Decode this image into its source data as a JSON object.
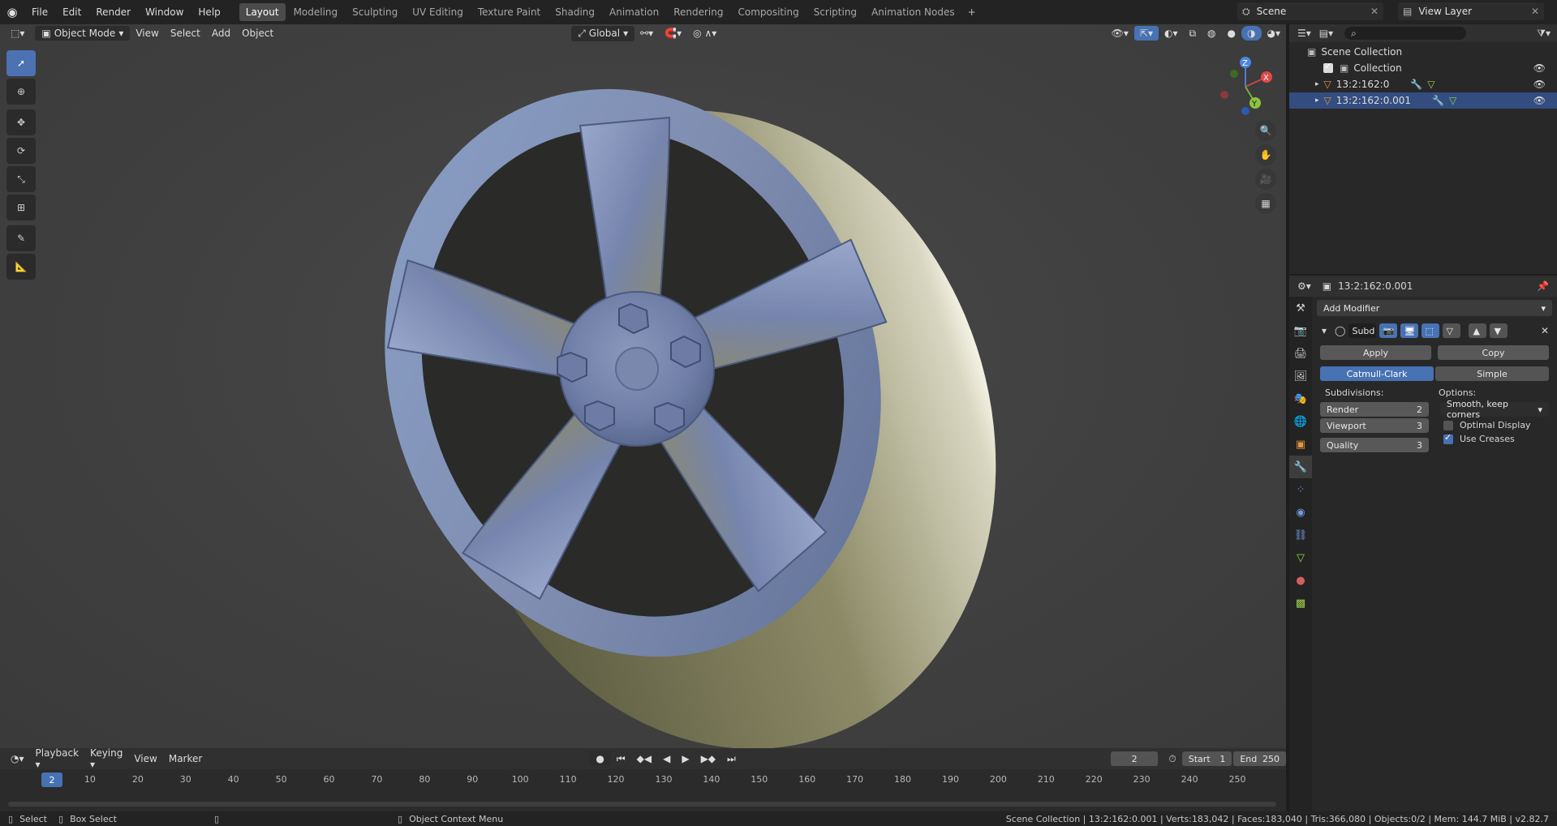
{
  "menu": [
    "File",
    "Edit",
    "Render",
    "Window",
    "Help"
  ],
  "workspaces": [
    "Layout",
    "Modeling",
    "Sculpting",
    "UV Editing",
    "Texture Paint",
    "Shading",
    "Animation",
    "Rendering",
    "Compositing",
    "Scripting",
    "Animation Nodes"
  ],
  "scene": {
    "name": "Scene",
    "view_layer": "View Layer"
  },
  "viewport_header": {
    "mode": "Object Mode",
    "view": "View",
    "select": "Select",
    "add": "Add",
    "object": "Object",
    "orientation": "Global"
  },
  "gizmo": {
    "x": "X",
    "y": "Y",
    "z": "Z"
  },
  "outliner": {
    "scene_collection": "Scene Collection",
    "collection": "Collection",
    "objects": [
      "13:2:162:0",
      "13:2:162:0.001"
    ]
  },
  "properties": {
    "object_name": "13:2:162:0.001",
    "add_modifier": "Add Modifier",
    "modifier_name": "Subd",
    "apply": "Apply",
    "copy": "Copy",
    "catmull": "Catmull-Clark",
    "simple": "Simple",
    "subdivisions_label": "Subdivisions:",
    "options_label": "Options:",
    "render_label": "Render",
    "render_value": "2",
    "viewport_label": "Viewport",
    "viewport_value": "3",
    "quality_label": "Quality",
    "quality_value": "3",
    "uv_smooth": "Smooth, keep corners",
    "optimal_display": "Optimal Display",
    "use_creases": "Use Creases"
  },
  "timeline": {
    "playback": "Playback",
    "keying": "Keying",
    "view": "View",
    "marker": "Marker",
    "current_frame": "2",
    "start_label": "Start",
    "start": "1",
    "end_label": "End",
    "end": "250",
    "ticks": [
      "10",
      "20",
      "30",
      "40",
      "50",
      "60",
      "70",
      "80",
      "90",
      "100",
      "110",
      "120",
      "130",
      "140",
      "150",
      "160",
      "170",
      "180",
      "190",
      "200",
      "210",
      "220",
      "230",
      "240",
      "250"
    ],
    "ruler_frame": "2"
  },
  "statusbar": {
    "select": "Select",
    "box_select": "Box Select",
    "context_menu": "Object Context Menu",
    "stats": "Scene Collection | 13:2:162:0.001 | Verts:183,042 | Faces:183,040 | Tris:366,080 | Objects:0/2 | Mem: 144.7 MiB | v2.82.7"
  }
}
